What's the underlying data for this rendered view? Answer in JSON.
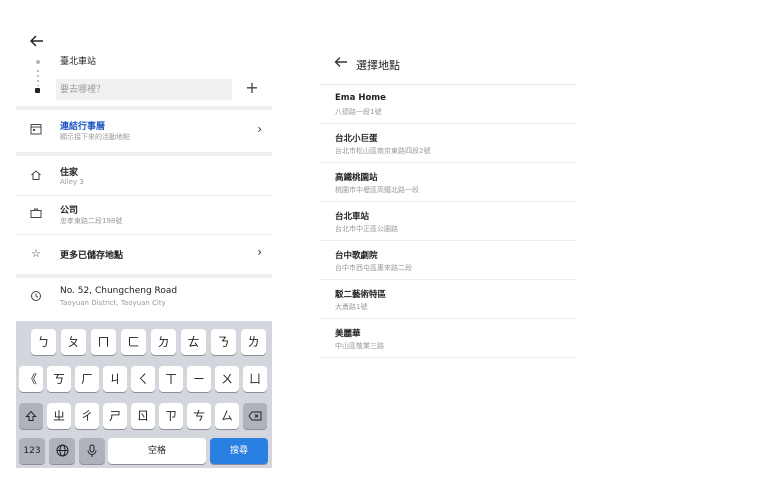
{
  "left": {
    "origin": "臺北車站",
    "destination_placeholder": "要去哪裡？",
    "rows": [
      {
        "title": "連結行事曆",
        "subtitle": "顯示接下來的活動地點",
        "icon": "calendar-icon"
      },
      {
        "title": "住家",
        "subtitle": "Alley 3",
        "icon": "home-icon"
      },
      {
        "title": "公司",
        "subtitle": "忠孝東路二段198號",
        "icon": "briefcase-icon"
      },
      {
        "title": "更多已儲存地點",
        "subtitle": "",
        "icon": "star-icon"
      },
      {
        "title": "No. 52, Chungcheng Road",
        "subtitle": "Taoyuan District, Taoyuan City",
        "icon": "history-icon"
      }
    ],
    "keyboard": {
      "row1": [
        "ㄅ",
        "ㄆ",
        "ㄇ",
        "ㄈ",
        "ㄉ",
        "ㄊ",
        "ㄋ",
        "ㄌ"
      ],
      "row2": [
        "《",
        "ㄎ",
        "ㄏ",
        "ㄐ",
        "ㄑ",
        "ㄒ",
        "ㄧ",
        "ㄨ",
        "ㄩ"
      ],
      "row3": [
        "ㄓ",
        "ㄔ",
        "ㄕ",
        "ㄖ",
        "ㄗ",
        "ㄘ",
        "ㄙ"
      ],
      "num_label": "123",
      "space_label": "空格",
      "search_label": "搜尋"
    }
  },
  "right": {
    "title": "選擇地點",
    "places": [
      {
        "name": "Ema Home",
        "address": "八德路一段1號"
      },
      {
        "name": "台北小巨蛋",
        "address": "台北市松山區南京東路四段2號"
      },
      {
        "name": "高鐵桃園站",
        "address": "桃園市中壢區高鐵北路一段"
      },
      {
        "name": "台北車站",
        "address": "台北市中正區公園路"
      },
      {
        "name": "台中歌劇院",
        "address": "台中市西屯區惠來路二段"
      },
      {
        "name": "駁二藝術特區",
        "address": "大勇路1號"
      },
      {
        "name": "美麗華",
        "address": "中山區敬業三路"
      }
    ]
  },
  "colors": {
    "accent": "#1e56c7",
    "search_key": "#2a7fe3",
    "keyboard_bg": "#d3d6dc"
  }
}
